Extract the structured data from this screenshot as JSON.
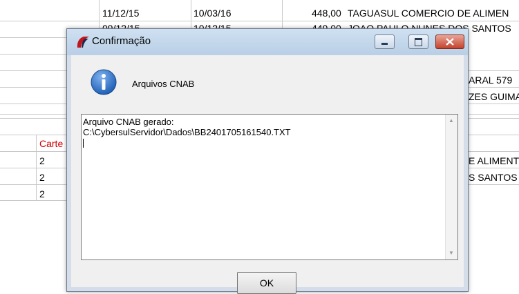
{
  "background": {
    "rows": [
      {
        "date1": "11/12/15",
        "date2": "10/03/16",
        "value": "448,00",
        "name": "TAGUASUL COMERCIO DE ALIMEN"
      },
      {
        "date1": "09/12/15",
        "date2": "10/12/15",
        "value": "449,00",
        "name": "JOAO PAULO NUNES DOS SANTOS"
      }
    ],
    "right_fragments": [
      "ARAL 579",
      "ZES GUIMA"
    ],
    "lower_header": "Carte",
    "lower_col_values": [
      "2",
      "2",
      "2"
    ],
    "lower_right_fragments": [
      "E ALIMENT",
      "S SANTOS"
    ]
  },
  "dialog": {
    "title": "Confirmação",
    "message": "Arquivos CNAB",
    "text_line1": "Arquivo CNAB gerado:",
    "text_line2": "C:\\CybersulServidor\\Dados\\BB2401705161540.TXT",
    "ok_label": "OK",
    "icons": {
      "title": "app-logo-icon",
      "info": "info-icon",
      "minimize": "minimize-icon",
      "maximize": "maximize-icon",
      "close": "close-icon"
    },
    "colors": {
      "close": "#c4422b",
      "info": "#1f5fb4",
      "logo": "#c0161d"
    }
  }
}
